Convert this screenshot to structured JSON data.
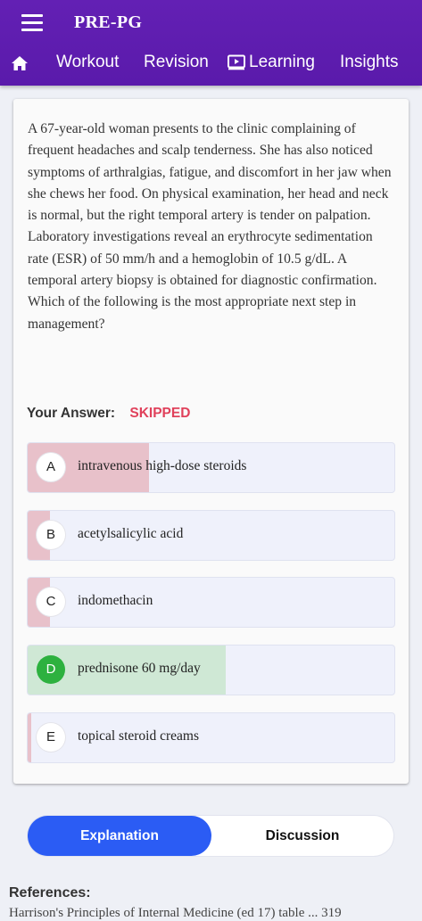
{
  "app": {
    "title": "PRE-PG",
    "menu_icon": "hamburger-menu-icon"
  },
  "nav": {
    "home_icon": "home-icon",
    "items": [
      {
        "label": "Workout"
      },
      {
        "label": "Revision"
      },
      {
        "label": "Learning",
        "icon": "play-screen-icon"
      },
      {
        "label": "Insights"
      }
    ]
  },
  "question": {
    "text": "A 67-year-old woman presents to the clinic complaining of frequent headaches and scalp tenderness. She has also noticed symptoms of arthralgias, fatigue, and discomfort in her jaw when she chews her food. On physical examination, her head and neck is normal, but the right temporal artery is tender on palpation. Laboratory investigations reveal an erythrocyte sedimentation rate (ESR) of 50 mm/h and a hemoglobin of 10.5 g/dL. A temporal artery biopsy is obtained for diagnostic confirmation. Which of the following is the most appropriate next step in management?"
  },
  "answer": {
    "label": "Your Answer:",
    "value": "SKIPPED",
    "value_color": "#e0415b"
  },
  "options": [
    {
      "letter": "A",
      "text": "intravenous high-dose steroids",
      "response_fraction": 0.33,
      "bar_color": "#e8c1ca",
      "correct": false
    },
    {
      "letter": "B",
      "text": "acetylsalicylic acid",
      "response_fraction": 0.06,
      "bar_color": "#e8c1ca",
      "correct": false
    },
    {
      "letter": "C",
      "text": "indomethacin",
      "response_fraction": 0.06,
      "bar_color": "#e8c1ca",
      "correct": false
    },
    {
      "letter": "D",
      "text": "prednisone 60 mg/day",
      "response_fraction": 0.54,
      "bar_color": "#cfe8d5",
      "correct": true
    },
    {
      "letter": "E",
      "text": "topical steroid creams",
      "response_fraction": 0.01,
      "bar_color": "#e8c1ca",
      "correct": false
    }
  ],
  "tabs": {
    "explanation": "Explanation",
    "discussion": "Discussion",
    "active_color": "#2b5cf4"
  },
  "references": {
    "title": "References:",
    "text": "Harrison's Principles of Internal Medicine (ed 17) table ... 319"
  }
}
